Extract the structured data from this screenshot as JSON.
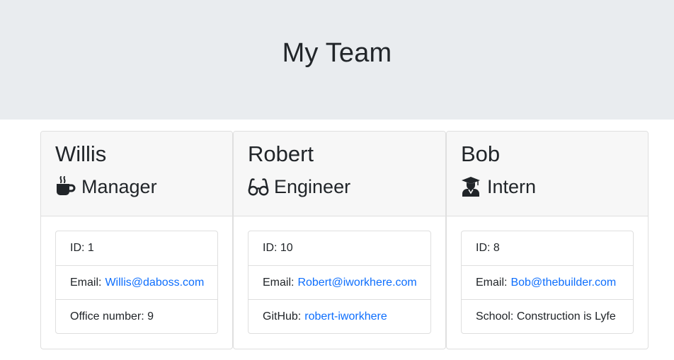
{
  "header": {
    "title": "My Team"
  },
  "colors": {
    "jumbotron_bg": "#e9ecef",
    "link": "#0d6efd"
  },
  "cards": [
    {
      "name": "Willis",
      "role": "Manager",
      "role_icon": "coffee-icon",
      "id_label": "ID: 1",
      "email_label": "Email:",
      "email": "Willis@daboss.com",
      "extra_label": "Office number: 9"
    },
    {
      "name": "Robert",
      "role": "Engineer",
      "role_icon": "glasses-icon",
      "id_label": "ID: 10",
      "email_label": "Email:",
      "email": "Robert@iworkhere.com",
      "extra_label": "GitHub:",
      "extra_link": "robert-iworkhere"
    },
    {
      "name": "Bob",
      "role": "Intern",
      "role_icon": "graduate-icon",
      "id_label": "ID: 8",
      "email_label": "Email:",
      "email": "Bob@thebuilder.com",
      "extra_label": "School: Construction is Lyfe"
    }
  ]
}
